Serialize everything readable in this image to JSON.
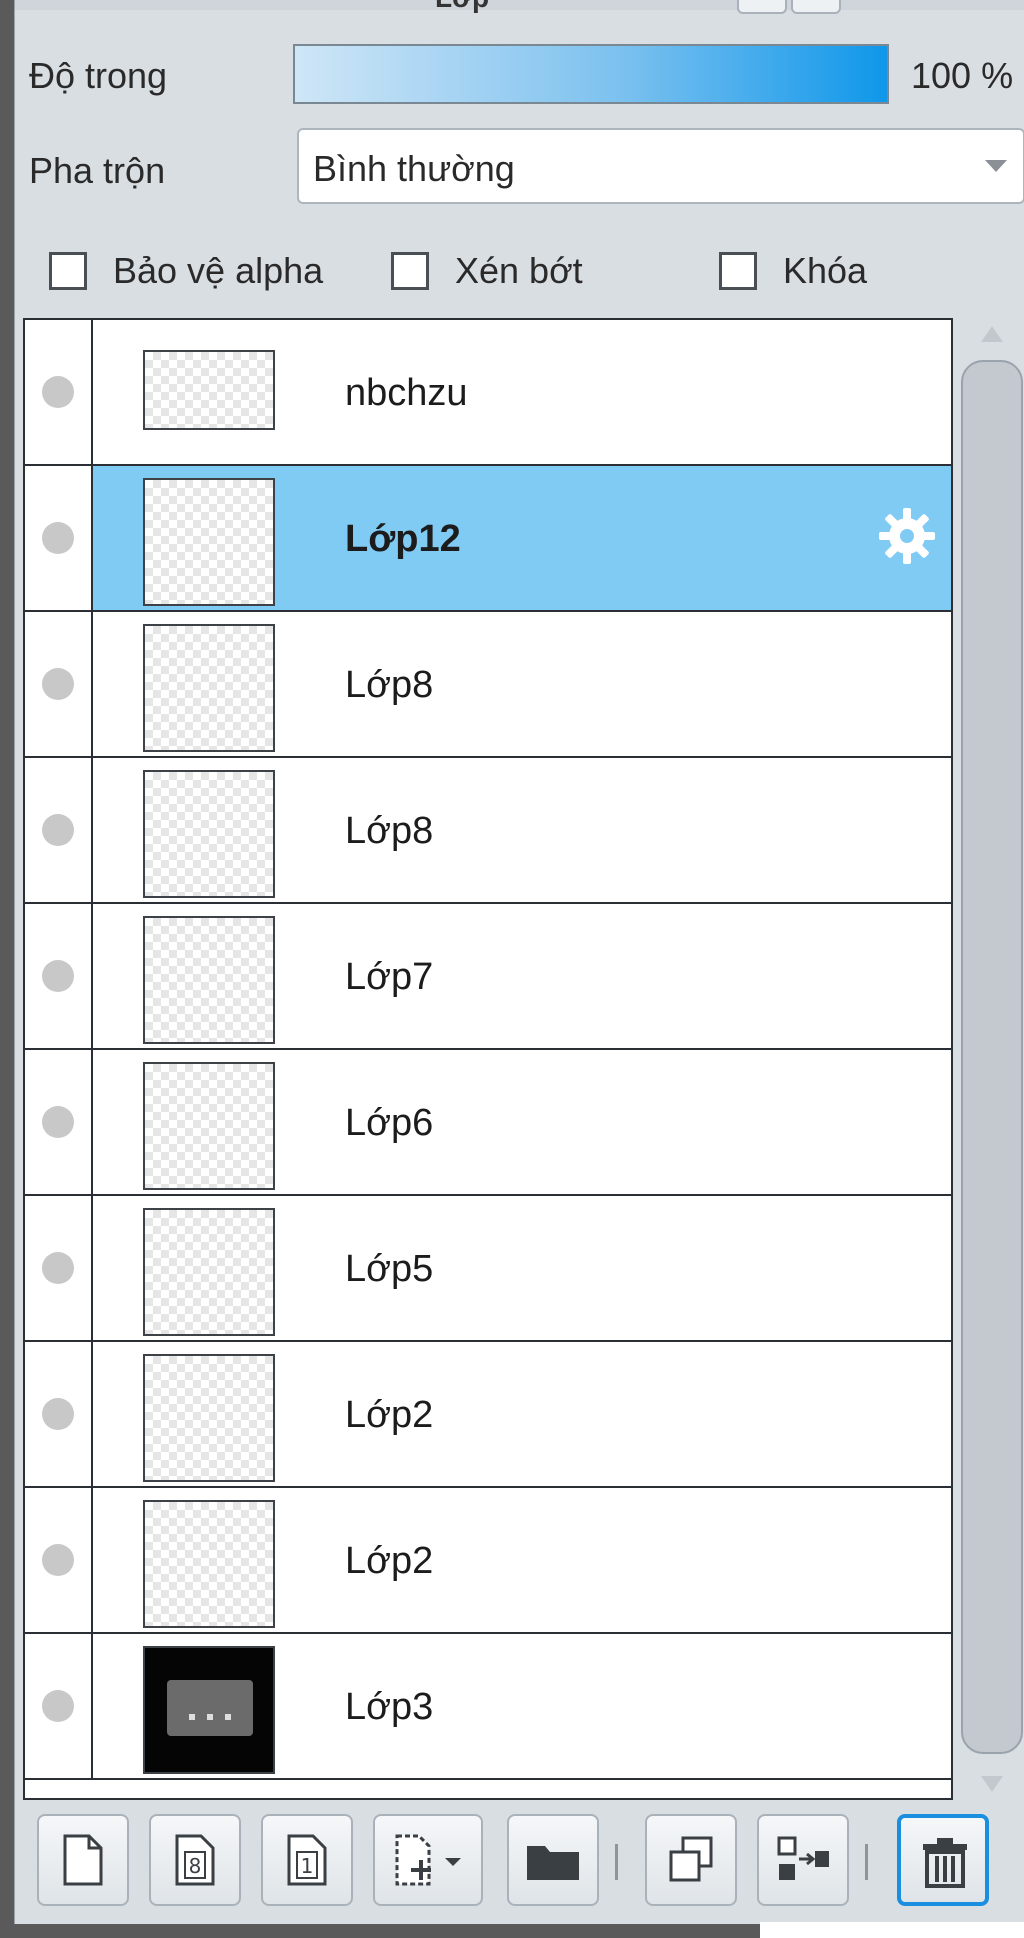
{
  "window": {
    "title": "Lớp"
  },
  "opacity": {
    "label": "Độ trong",
    "value": "100 %"
  },
  "blend": {
    "label": "Pha trộn",
    "value": "Bình thường"
  },
  "checkboxes": [
    {
      "label": "Bảo vệ alpha",
      "checked": false
    },
    {
      "label": "Xén bớt",
      "checked": false
    },
    {
      "label": "Khóa",
      "checked": false
    }
  ],
  "layers": [
    {
      "name": "nbchzu",
      "selected": false,
      "thumb": "transparent-short"
    },
    {
      "name": "Lớp12",
      "selected": true,
      "thumb": "transparent"
    },
    {
      "name": "Lớp8",
      "selected": false,
      "thumb": "transparent"
    },
    {
      "name": "Lớp8",
      "selected": false,
      "thumb": "transparent"
    },
    {
      "name": "Lớp7",
      "selected": false,
      "thumb": "transparent"
    },
    {
      "name": "Lớp6",
      "selected": false,
      "thumb": "transparent"
    },
    {
      "name": "Lớp5",
      "selected": false,
      "thumb": "transparent"
    },
    {
      "name": "Lớp2",
      "selected": false,
      "thumb": "transparent"
    },
    {
      "name": "Lớp2",
      "selected": false,
      "thumb": "transparent"
    },
    {
      "name": "Lớp3",
      "selected": false,
      "thumb": "dark"
    }
  ],
  "toolbar": {
    "buttons": [
      {
        "icon": "new-layer-icon"
      },
      {
        "icon": "new-8bit-layer-icon"
      },
      {
        "icon": "new-1bit-layer-icon"
      },
      {
        "icon": "add-layer-dropdown-icon"
      },
      {
        "icon": "folder-icon"
      },
      {
        "icon": "duplicate-layer-icon"
      },
      {
        "icon": "merge-down-icon"
      },
      {
        "icon": "trash-icon"
      }
    ]
  },
  "colors": {
    "selection": "#7fcbf3",
    "accent": "#1a8fe0",
    "panel": "#d9dee3"
  }
}
